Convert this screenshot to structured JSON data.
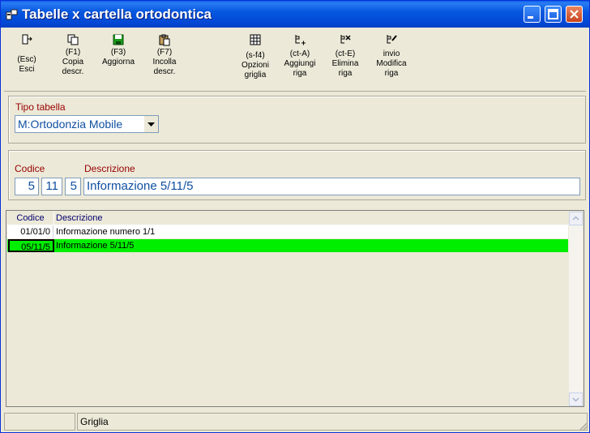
{
  "window": {
    "title": "Tabelle x cartella ortodontica"
  },
  "toolbar": {
    "items": [
      {
        "key": "(Esc)",
        "label": "Esci"
      },
      {
        "key": "(F1)",
        "label": "Copia\ndescr."
      },
      {
        "key": "(F3)",
        "label": "Aggiorna"
      },
      {
        "key": "(F7)",
        "label": "Incolla\ndescr."
      },
      {
        "key": "(s-f4)",
        "label": "Opzioni\ngriglia"
      },
      {
        "key": "(ct-A)",
        "label": "Aggiungi\nriga"
      },
      {
        "key": "(ct-E)",
        "label": "Elimina\nriga"
      },
      {
        "key": "invio",
        "label": "Modifica\nriga"
      }
    ]
  },
  "tipo": {
    "label": "Tipo tabella",
    "value": "M:Ortodonzia Mobile"
  },
  "codice": {
    "label_codice": "Codice",
    "label_descrizione": "Descrizione",
    "c1": "5",
    "c2": "11",
    "c3": "5",
    "descrizione": "Informazione 5/11/5"
  },
  "grid": {
    "headers": [
      "Codice",
      "Descrizione"
    ],
    "rows": [
      {
        "codice": "01/01/0",
        "descrizione": "Informazione numero 1/1"
      },
      {
        "codice": "05/11/5",
        "descrizione": "Informazione 5/11/5"
      }
    ],
    "selected_row_color": "#00ee00"
  },
  "status": {
    "panel2": "Griglia"
  }
}
